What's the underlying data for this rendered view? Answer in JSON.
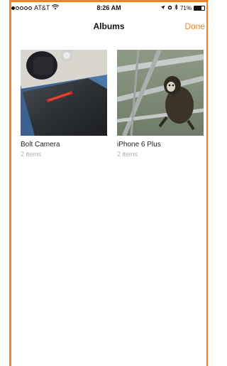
{
  "status_bar": {
    "carrier": "AT&T",
    "time": "8:26 AM",
    "battery": "71%",
    "battery_level": 0.71
  },
  "nav": {
    "title": "Albums",
    "done_label": "Done"
  },
  "albums": [
    {
      "title": "Bolt Camera",
      "count": "2 items"
    },
    {
      "title": "iPhone 6 Plus",
      "count": "2 items"
    }
  ],
  "colors": {
    "accent": "#f0822a",
    "subtext": "#b0b0b0"
  }
}
